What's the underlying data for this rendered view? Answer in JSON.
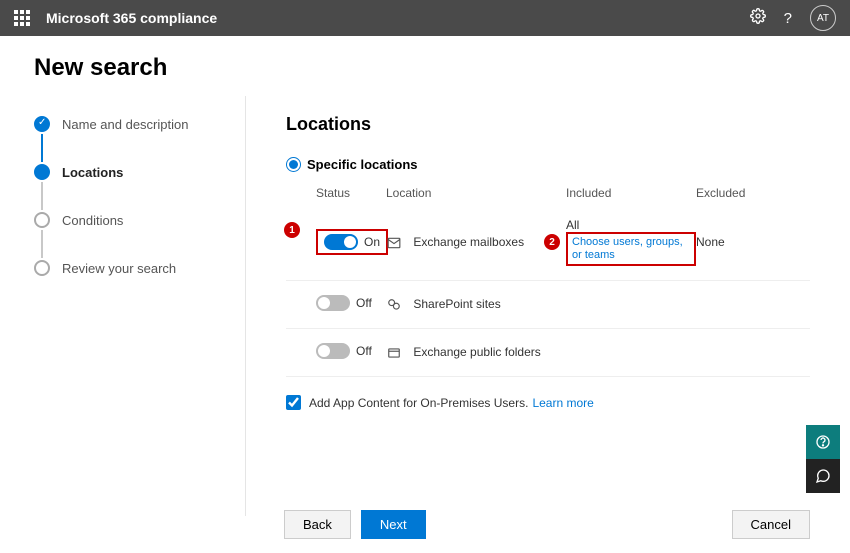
{
  "header": {
    "app_title": "Microsoft 365 compliance",
    "avatar_initials": "AT"
  },
  "page": {
    "title": "New search"
  },
  "steps": [
    {
      "label": "Name and description"
    },
    {
      "label": "Locations"
    },
    {
      "label": "Conditions"
    },
    {
      "label": "Review your search"
    }
  ],
  "locations": {
    "heading": "Locations",
    "specific_label": "Specific locations",
    "columns": {
      "status": "Status",
      "location": "Location",
      "included": "Included",
      "excluded": "Excluded"
    },
    "toggle_on": "On",
    "toggle_off": "Off",
    "rows": [
      {
        "name": "Exchange mailboxes",
        "on": true,
        "included": "All",
        "excluded": "None",
        "choose": "Choose users, groups, or teams"
      },
      {
        "name": "SharePoint sites",
        "on": false
      },
      {
        "name": "Exchange public folders",
        "on": false
      }
    ],
    "add_app_content": "Add App Content for On-Premises Users.",
    "learn_more": "Learn more"
  },
  "callouts": {
    "one": "1",
    "two": "2"
  },
  "footer": {
    "back": "Back",
    "next": "Next",
    "cancel": "Cancel"
  }
}
